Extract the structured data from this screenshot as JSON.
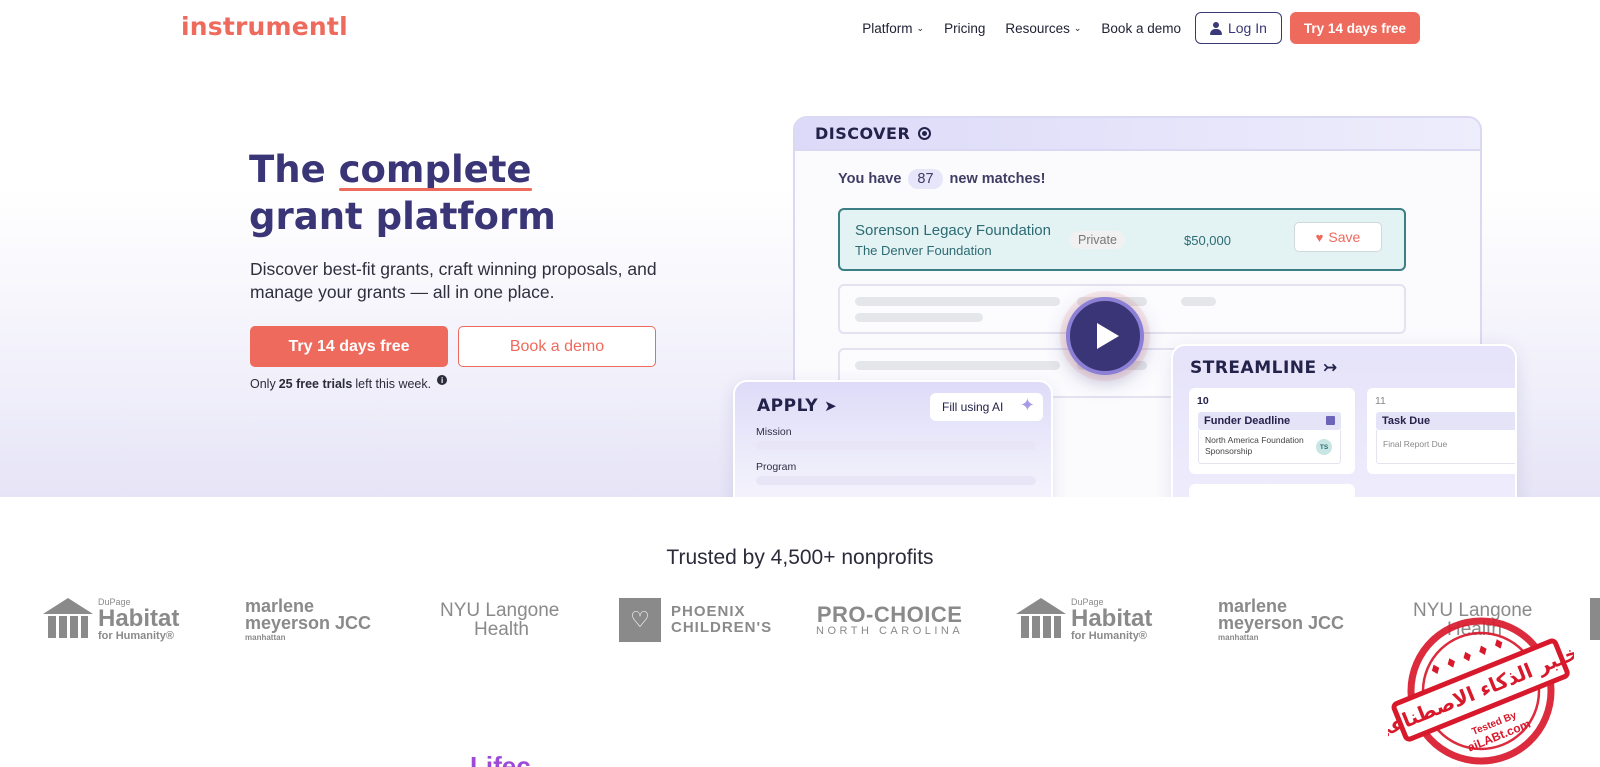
{
  "nav": {
    "logo": "instrumentl",
    "platform": "Platform",
    "pricing": "Pricing",
    "resources": "Resources",
    "book_demo": "Book a demo",
    "login": "Log In",
    "trial": "Try 14 days free"
  },
  "hero": {
    "title_word1": "The",
    "title_word2": "complete",
    "title_line2": "grant platform",
    "subtitle": "Discover best-fit grants, craft winning proposals, and manage your grants — all in one place.",
    "cta_trial": "Try 14 days free",
    "cta_demo": "Book a demo",
    "note_pre": "Only",
    "note_bold": "25 free trials",
    "note_post": "left this week."
  },
  "discover": {
    "title": "DISCOVER",
    "matches_pre": "You have",
    "matches_count": "87",
    "matches_post": "new matches!",
    "row": {
      "name": "Sorenson Legacy Foundation",
      "org": "The Denver Foundation",
      "tag": "Private",
      "amount": "$50,000",
      "save": "Save"
    }
  },
  "apply": {
    "title": "APPLY",
    "fill_ai": "Fill using AI",
    "label_mission": "Mission",
    "label_program": "Program"
  },
  "streamline": {
    "title": "STREAMLINE",
    "col1": {
      "day": "10",
      "task": "Funder Deadline",
      "detail": "North America Foundation Sponsorship",
      "avatar": "TS"
    },
    "col2": {
      "day": "11",
      "task": "Task Due",
      "detail": "Final Report Due"
    }
  },
  "trusted": {
    "heading": "Trusted by 4,500+ nonprofits",
    "logos": {
      "habitat_top": "DuPage",
      "habitat_main": "Habitat",
      "habitat_sub": "for Humanity®",
      "mm_line1": "marlene",
      "mm_line2": "meyerson JCC",
      "mm_line3": "manhattan",
      "nyu_line1": "NYU Langone",
      "nyu_line2": "Health",
      "phoenix_line1": "PHOENIX",
      "phoenix_line2": "CHILDREN'S",
      "pc_line1": "PRO-CHOICE",
      "pc_line2": "NORTH CAROLINA"
    }
  },
  "section_peek": "Lifec",
  "stamp": {
    "arabic": "مختبر الذكاء الاصطناعي",
    "tested_by": "Tested By",
    "site": "aiLABt.com"
  },
  "colors": {
    "brand_coral": "#ee6a5c",
    "brand_navy": "#3a3576",
    "teal": "#3b7e85",
    "stamp_red": "#d8192b"
  }
}
